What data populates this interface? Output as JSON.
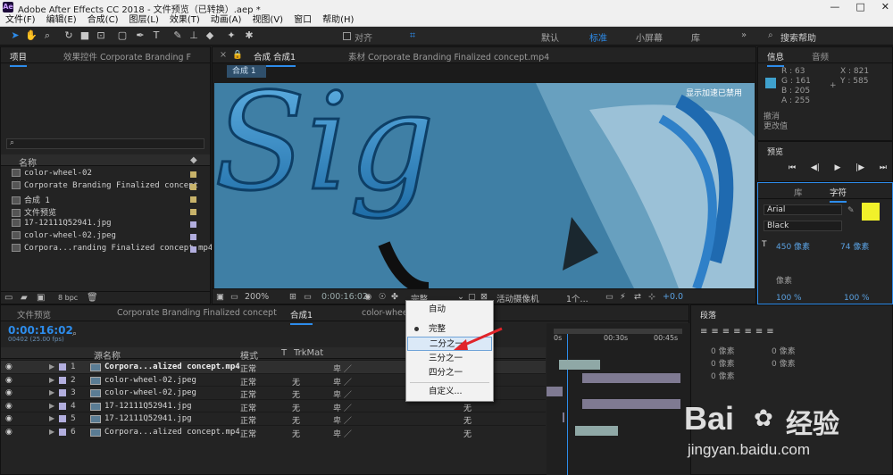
{
  "app": {
    "title": "Adobe After Effects CC 2018 - 文件预览（已转换）.aep *",
    "icon_text": "Ae",
    "window_buttons": [
      "—",
      "□",
      "✕"
    ]
  },
  "menu_bar": [
    "文件(F)",
    "编辑(E)",
    "合成(C)",
    "图层(L)",
    "效果(T)",
    "动画(A)",
    "视图(V)",
    "窗口",
    "帮助(H)"
  ],
  "toolbar": {
    "align_label": "对齐",
    "workspaces": [
      "默认",
      "标准",
      "小屏幕",
      "库"
    ],
    "active_workspace": "标准",
    "search_placeholder": "搜索帮助"
  },
  "project_panel": {
    "tabs": [
      "项目",
      "效果控件 Corporate Branding F"
    ],
    "name_header": "名称",
    "items": [
      {
        "name": "color-wheel-02",
        "color": "#c8b36a"
      },
      {
        "name": "Corporate Branding  Finalized concept",
        "color": "#c8b36a"
      },
      {
        "name": "合成 1",
        "color": "#c8b36a"
      },
      {
        "name": "文件预览",
        "color": "#c8b36a"
      },
      {
        "name": "17-12111Q52941.jpg",
        "color": "#b2aede"
      },
      {
        "name": "color-wheel-02.jpeg",
        "color": "#b2aede"
      },
      {
        "name": "Corpora...randing  Finalized concept.mp4",
        "color": "#b2aede"
      }
    ],
    "bpc": "8 bpc"
  },
  "viewer": {
    "tabs": [
      "合成 合成1",
      "素材 Corporate Branding  Finalized concept.mp4"
    ],
    "sub_tab": "合成 1",
    "overlay_text": "显示加速已禁用",
    "zoom": "200%",
    "timecode": "0:00:16:02",
    "resolution": "完整",
    "camera": "活动摄像机",
    "views": "1个...",
    "exposure": "+0.0"
  },
  "info_panel": {
    "tabs": [
      "信息",
      "音频"
    ],
    "color_swatch": "#3fa1cd",
    "r": "R : 63",
    "g": "G : 161",
    "b": "B : 205",
    "a": "A : 255",
    "x": "X : 821",
    "y": "Y : 585",
    "undo": "撤消",
    "redo": "更改值"
  },
  "preview_panel": {
    "title": "预览",
    "controls": [
      "⏮",
      "◀|",
      "▶",
      "|▶",
      "⏭"
    ]
  },
  "character_panel": {
    "tabs": [
      "库",
      "字符"
    ],
    "font": "Arial",
    "style": "Black",
    "fill_color": "#f1f12a",
    "size": "450 像素",
    "leading": "74 像素",
    "kerning": "像素",
    "scale_h": "100 %",
    "scale_v": "100 %"
  },
  "timeline": {
    "tabs": [
      "文件预览",
      "Corporate Branding  Finalized concept",
      "合成1",
      "color-wheel-0"
    ],
    "timecode": "0:00:16:02",
    "fps": "00402 (25.00 fps)",
    "col_source": "源名称",
    "col_mode": "模式",
    "col_t": "T",
    "col_trkmat": "TrkMat",
    "ruler": [
      "0s",
      "00:30s",
      "00:45s"
    ],
    "layers": [
      {
        "num": "1",
        "name": "Corpora...alized concept.mp4",
        "mode": "正常",
        "trkmat": "",
        "parent": "无",
        "color": "#b2aede",
        "bold": true
      },
      {
        "num": "2",
        "name": "color-wheel-02.jpeg",
        "mode": "正常",
        "trkmat": "无",
        "parent": "无",
        "color": "#b2aede",
        "bold": false
      },
      {
        "num": "3",
        "name": "color-wheel-02.jpeg",
        "mode": "正常",
        "trkmat": "无",
        "parent": "无",
        "color": "#b2aede",
        "bold": false
      },
      {
        "num": "4",
        "name": "17-12111Q52941.jpg",
        "mode": "正常",
        "trkmat": "无",
        "parent": "无",
        "color": "#b2aede",
        "bold": false
      },
      {
        "num": "5",
        "name": "17-12111Q52941.jpg",
        "mode": "正常",
        "trkmat": "无",
        "parent": "无",
        "color": "#b2aede",
        "bold": false
      },
      {
        "num": "6",
        "name": "Corpora...alized concept.mp4",
        "mode": "正常",
        "trkmat": "无",
        "parent": "无",
        "color": "#b2aede",
        "bold": false
      }
    ]
  },
  "paragraph_panel": {
    "title": "段落",
    "values": [
      "0 像素",
      "0 像素",
      "0 像素",
      "0 像素",
      "0 像素"
    ]
  },
  "resolution_menu": {
    "items": [
      "自动",
      "完整",
      "二分之一",
      "三分之一",
      "四分之一",
      "自定义..."
    ],
    "checked": "完整",
    "highlighted": "二分之一"
  },
  "watermark": {
    "brand": "Bai",
    "brand2": "经验",
    "url": "jingyan.baidu.com"
  }
}
